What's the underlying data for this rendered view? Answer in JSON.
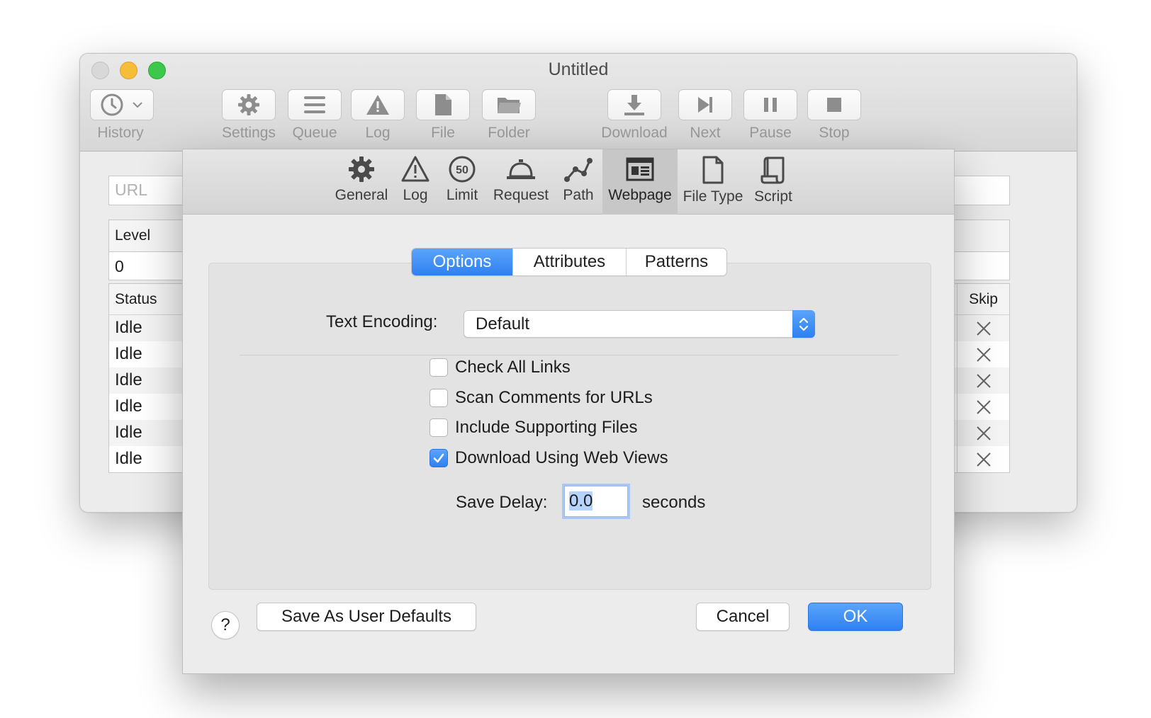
{
  "window": {
    "title": "Untitled"
  },
  "toolbar": {
    "items": [
      {
        "label": "History",
        "icon": "clock-icon"
      },
      {
        "label": "Settings",
        "icon": "gear-icon"
      },
      {
        "label": "Queue",
        "icon": "list-icon"
      },
      {
        "label": "Log",
        "icon": "warning-icon"
      },
      {
        "label": "File",
        "icon": "file-icon"
      },
      {
        "label": "Folder",
        "icon": "folder-icon"
      },
      {
        "label": "Download",
        "icon": "download-icon"
      },
      {
        "label": "Next",
        "icon": "next-icon"
      },
      {
        "label": "Pause",
        "icon": "pause-icon"
      },
      {
        "label": "Stop",
        "icon": "stop-icon"
      }
    ]
  },
  "main": {
    "url_placeholder": "URL",
    "level_header": "Level",
    "level_value": "0",
    "status_header": "Status",
    "skip_header": "Skip",
    "rows": [
      "Idle",
      "Idle",
      "Idle",
      "Idle",
      "Idle",
      "Idle"
    ]
  },
  "prefs": {
    "tabs": [
      {
        "label": "General",
        "icon": "gear-icon"
      },
      {
        "label": "Log",
        "icon": "warning-icon"
      },
      {
        "label": "Limit",
        "icon": "speed-limit-icon",
        "badge": "50"
      },
      {
        "label": "Request",
        "icon": "bell-icon"
      },
      {
        "label": "Path",
        "icon": "path-icon"
      },
      {
        "label": "Webpage",
        "icon": "webpage-icon",
        "selected": true
      },
      {
        "label": "File Type",
        "icon": "file-icon"
      },
      {
        "label": "Script",
        "icon": "script-icon"
      }
    ],
    "segments": [
      {
        "label": "Options",
        "active": true
      },
      {
        "label": "Attributes"
      },
      {
        "label": "Patterns"
      }
    ],
    "text_encoding_label": "Text Encoding:",
    "text_encoding_value": "Default",
    "checkboxes": [
      {
        "label": "Check All Links",
        "checked": false
      },
      {
        "label": "Scan Comments for URLs",
        "checked": false
      },
      {
        "label": "Include Supporting Files",
        "checked": false
      },
      {
        "label": "Download Using Web Views",
        "checked": true
      }
    ],
    "save_delay_label": "Save Delay:",
    "save_delay_value": "0.0",
    "save_delay_unit": "seconds",
    "help_label": "?",
    "save_defaults_label": "Save As User Defaults",
    "cancel_label": "Cancel",
    "ok_label": "OK"
  },
  "colors": {
    "accent": "#2f80f2",
    "selected_tab": "#c7c7c7"
  }
}
